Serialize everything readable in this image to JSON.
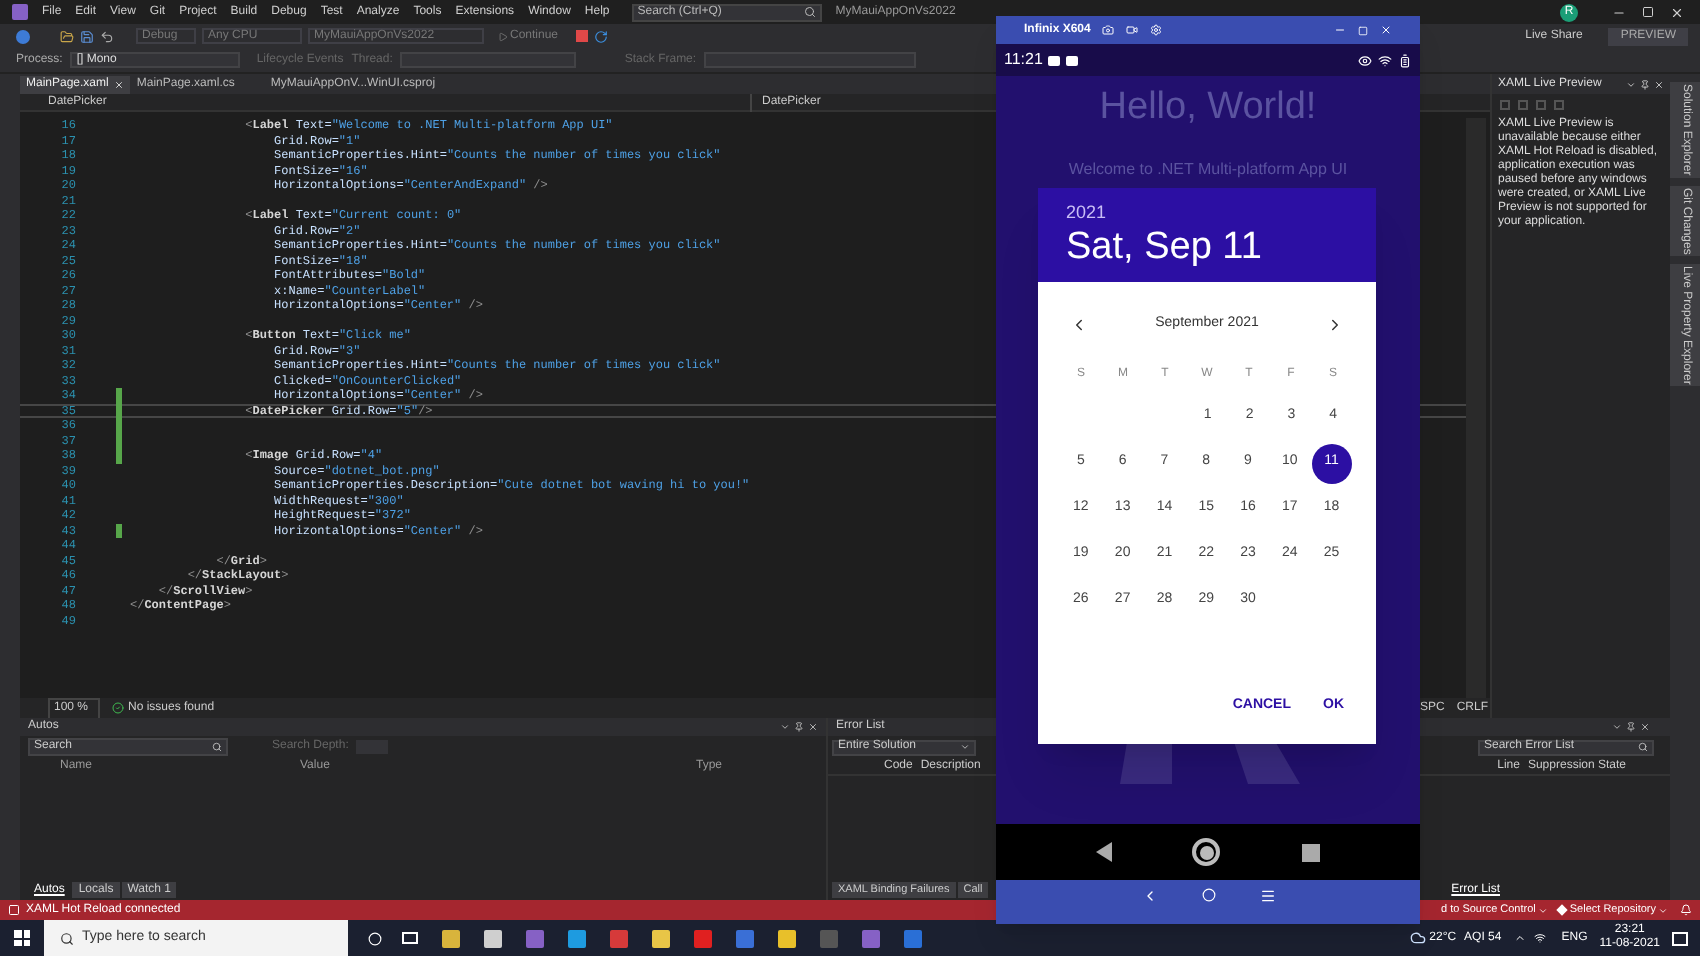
{
  "title_bar": {
    "menus": [
      "File",
      "Edit",
      "View",
      "Git",
      "Project",
      "Build",
      "Debug",
      "Test",
      "Analyze",
      "Tools",
      "Extensions",
      "Window",
      "Help"
    ],
    "search_placeholder": "Search (Ctrl+Q)",
    "solution": "MyMauiAppOnVs2022",
    "avatar": "R",
    "live_share": "Live Share",
    "preview": "PREVIEW"
  },
  "toolbar": {
    "configuration": "Debug",
    "platform": "Any CPU",
    "project": "MyMauiAppOnVs2022",
    "continue": "Continue"
  },
  "debug_location": {
    "process_label": "Process:",
    "process": "[] Mono",
    "lifecycle": "Lifecycle Events",
    "thread_label": "Thread:",
    "stack_frame_label": "Stack Frame:"
  },
  "editor_tabs": [
    {
      "label": "MainPage.xaml",
      "selected": true
    },
    {
      "label": "MainPage.xaml.cs",
      "selected": false
    },
    {
      "label": "MyMauiAppOnV...WinUI.csproj",
      "selected": false
    }
  ],
  "navigation": [
    "DatePicker",
    "DatePicker"
  ],
  "code_lines": [
    {
      "number": "16",
      "text": "                <Label Text=\"Welcome to .NET Multi-platform App UI\"",
      "changed": false,
      "current": false
    },
    {
      "number": "17",
      "text": "                    Grid.Row=\"1\"",
      "changed": false,
      "current": false
    },
    {
      "number": "18",
      "text": "                    SemanticProperties.Hint=\"Counts the number of times you click\"",
      "changed": false,
      "current": false
    },
    {
      "number": "19",
      "text": "                    FontSize=\"16\"",
      "changed": false,
      "current": false
    },
    {
      "number": "20",
      "text": "                    HorizontalOptions=\"CenterAndExpand\" />",
      "changed": false,
      "current": false
    },
    {
      "number": "21",
      "changed": false,
      "current": false
    },
    {
      "number": "22",
      "text": "                <Label Text=\"Current count: 0\"",
      "changed": false,
      "current": false
    },
    {
      "number": "23",
      "text": "                    Grid.Row=\"2\"",
      "changed": false,
      "current": false
    },
    {
      "number": "24",
      "text": "                    SemanticProperties.Hint=\"Counts the number of times you click\"",
      "changed": false,
      "current": false
    },
    {
      "number": "25",
      "text": "                    FontSize=\"18\"",
      "changed": false,
      "current": false
    },
    {
      "number": "26",
      "text": "                    FontAttributes=\"Bold\"",
      "changed": false,
      "current": false
    },
    {
      "number": "27",
      "text": "                    x:Name=\"CounterLabel\"",
      "changed": false,
      "current": false
    },
    {
      "number": "28",
      "text": "                    HorizontalOptions=\"Center\" />",
      "changed": false,
      "current": false
    },
    {
      "number": "29",
      "changed": false,
      "current": false
    },
    {
      "number": "30",
      "text": "                <Button Text=\"Click me\"",
      "changed": false,
      "current": false
    },
    {
      "number": "31",
      "text": "                    Grid.Row=\"3\"",
      "changed": false,
      "current": false
    },
    {
      "number": "32",
      "text": "                    SemanticProperties.Hint=\"Counts the number of times you click\"",
      "changed": false,
      "current": false
    },
    {
      "number": "33",
      "text": "                    Clicked=\"OnCounterClicked\"",
      "changed": false,
      "current": false
    },
    {
      "number": "34",
      "text": "                    HorizontalOptions=\"Center\" />",
      "changed": true,
      "current": false
    },
    {
      "number": "35",
      "text": "                <DatePicker Grid.Row=\"5\"/>",
      "changed": true,
      "current": true
    },
    {
      "number": "36",
      "changed": true,
      "current": false
    },
    {
      "number": "37",
      "changed": true,
      "current": false
    },
    {
      "number": "38",
      "text": "                <Image Grid.Row=\"4\"",
      "changed": true,
      "current": false
    },
    {
      "number": "39",
      "text": "                    Source=\"dotnet_bot.png\"",
      "changed": false,
      "current": false
    },
    {
      "number": "40",
      "text": "                    SemanticProperties.Description=\"Cute dotnet bot waving hi to you!\"",
      "changed": false,
      "current": false
    },
    {
      "number": "41",
      "text": "                    WidthRequest=\"300\"",
      "changed": false,
      "current": false
    },
    {
      "number": "42",
      "text": "                    HeightRequest=\"372\"",
      "changed": false,
      "current": false
    },
    {
      "number": "43",
      "text": "                    HorizontalOptions=\"Center\" />",
      "changed": true,
      "current": false
    },
    {
      "number": "44",
      "changed": false,
      "current": false
    },
    {
      "number": "45",
      "text": "            </Grid>",
      "changed": false,
      "current": false
    },
    {
      "number": "46",
      "text": "        </StackLayout>",
      "changed": false,
      "current": false
    },
    {
      "number": "47",
      "text": "    </ScrollView>",
      "changed": false,
      "current": false
    },
    {
      "number": "48",
      "text": "</ContentPage>",
      "changed": false,
      "current": false
    },
    {
      "number": "49",
      "changed": false,
      "current": false
    }
  ],
  "editor_status": {
    "zoom": "100 %",
    "issues": "No issues found",
    "whitespace": "SPC",
    "line_ending": "CRLF"
  },
  "live_preview": {
    "title": "XAML Live Preview",
    "message": "XAML Live Preview is unavailable because either XAML Hot Reload is disabled, application execution was paused before any windows were created, or XAML Live Preview is not supported for your application."
  },
  "side_tabs": [
    "Solution Explorer",
    "Git Changes",
    "Live Property Explorer"
  ],
  "autos": {
    "title": "Autos",
    "search_placeholder": "Search",
    "search_depth": "Search Depth:",
    "columns": [
      "Name",
      "Value",
      "Type"
    ],
    "tabs": [
      {
        "label": "Autos",
        "selected": true
      },
      {
        "label": "Locals",
        "selected": false
      },
      {
        "label": "Watch 1",
        "selected": false
      }
    ]
  },
  "error_list": {
    "title": "Error List",
    "scope": "Entire Solution",
    "columns_left": [
      "Code",
      "Description"
    ],
    "search_placeholder": "Search Error List",
    "columns_right": [
      "Line",
      "Suppression State"
    ],
    "tabs_left": [
      {
        "label": "XAML Binding Failures",
        "selected": false
      },
      {
        "label": "Call",
        "selected": false
      }
    ],
    "tabs_right": [
      {
        "label": "Error List",
        "selected": true
      }
    ]
  },
  "status_bar": {
    "hot_reload": "XAML Hot Reload connected",
    "source_control": "d to Source Control",
    "repository": "Select Repository"
  },
  "taskbar": {
    "search_placeholder": "Type here to search",
    "temperature": "22°C",
    "aqi": "AQI 54",
    "language": "ENG",
    "time": "23:21",
    "date": "11-08-2021"
  },
  "emulator": {
    "device": "Infinix X604",
    "time": "11:21",
    "heading": "Hello, World!",
    "welcome": "Welcome to .NET Multi-platform App UI",
    "date_picker": {
      "year": "2021",
      "date": "Sat, Sep 11",
      "month": "September 2021",
      "weekdays": [
        "S",
        "M",
        "T",
        "W",
        "T",
        "F",
        "S"
      ],
      "weeks": [
        [
          {
            "day": "1",
            "selected": false
          },
          {
            "day": "2",
            "selected": false
          },
          {
            "day": "3",
            "selected": false
          },
          {
            "day": "4",
            "selected": false
          }
        ],
        [
          {
            "day": "5",
            "selected": false
          },
          {
            "day": "6",
            "selected": false
          },
          {
            "day": "7",
            "selected": false
          },
          {
            "day": "8",
            "selected": false
          },
          {
            "day": "9",
            "selected": false
          },
          {
            "day": "10",
            "selected": false
          },
          {
            "day": "11",
            "selected": true
          }
        ],
        [
          {
            "day": "12",
            "selected": false
          },
          {
            "day": "13",
            "selected": false
          },
          {
            "day": "14",
            "selected": false
          },
          {
            "day": "15",
            "selected": false
          },
          {
            "day": "16",
            "selected": false
          },
          {
            "day": "17",
            "selected": false
          },
          {
            "day": "18",
            "selected": false
          }
        ],
        [
          {
            "day": "19",
            "selected": false
          },
          {
            "day": "20",
            "selected": false
          },
          {
            "day": "21",
            "selected": false
          },
          {
            "day": "22",
            "selected": false
          },
          {
            "day": "23",
            "selected": false
          },
          {
            "day": "24",
            "selected": false
          },
          {
            "day": "25",
            "selected": false
          }
        ],
        [
          {
            "day": "26",
            "selected": false
          },
          {
            "day": "27",
            "selected": false
          },
          {
            "day": "28",
            "selected": false
          },
          {
            "day": "29",
            "selected": false
          },
          {
            "day": "30",
            "selected": false
          }
        ]
      ],
      "buttons": [
        "CANCEL",
        "OK"
      ]
    }
  }
}
